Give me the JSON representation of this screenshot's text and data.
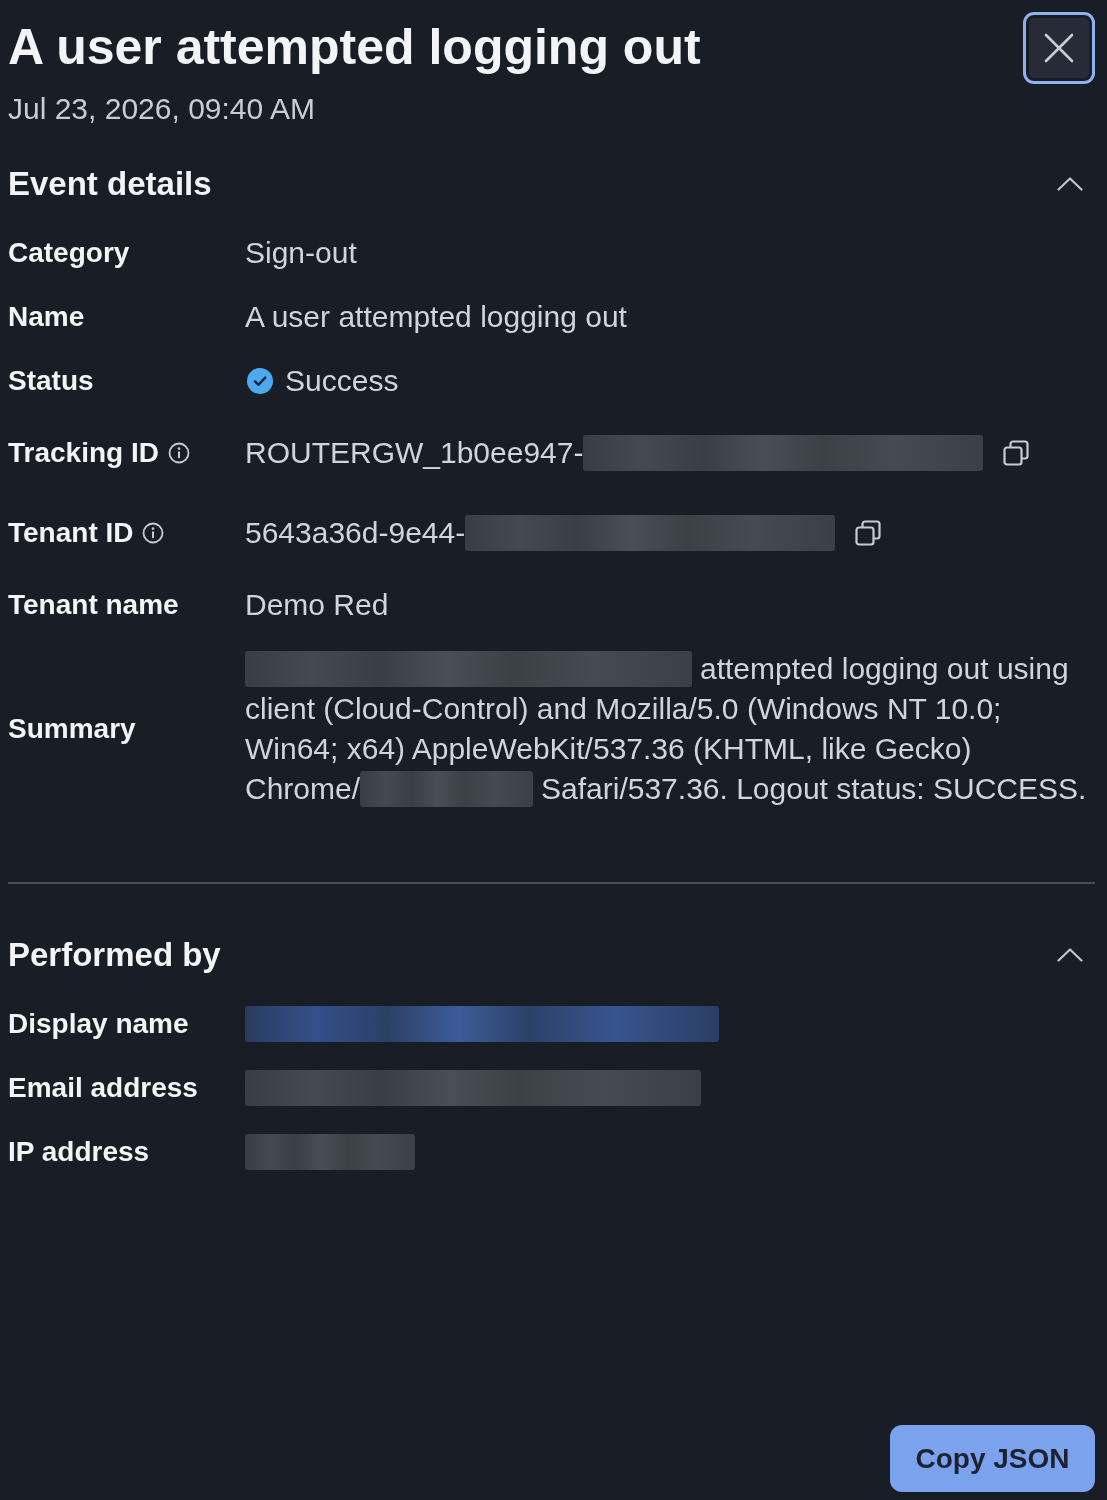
{
  "header": {
    "title": "A user attempted logging out",
    "timestamp": "Jul 23, 2026, 09:40 AM"
  },
  "sections": [
    {
      "title": "Event details",
      "expanded": true,
      "fields": [
        {
          "kind": "text",
          "label": "Category",
          "value": "Sign-out"
        },
        {
          "kind": "text",
          "label": "Name",
          "value": "A user attempted logging out"
        },
        {
          "kind": "status",
          "label": "Status",
          "value": "Success"
        },
        {
          "kind": "text",
          "label": "Tracking ID",
          "info": true,
          "value": "ROUTERGW_1b0ee947-",
          "redacted": true,
          "copyable": true
        },
        {
          "kind": "text",
          "label": "Tenant ID",
          "info": true,
          "value": "5643a36d-9e44-",
          "redacted": true,
          "copyable": true
        },
        {
          "kind": "text",
          "label": "Tenant name",
          "value": "Demo Red"
        },
        {
          "kind": "summary",
          "label": "Summary",
          "lines": [
            [
              {
                "kind": "redacted"
              },
              {
                "kind": "text",
                "text": "attempted logging out using"
              }
            ],
            [
              {
                "kind": "text",
                "text": "client (Cloud-Control) and Mozilla/5.0 (Windows NT 10.0;"
              }
            ],
            [
              {
                "kind": "text",
                "text": "Win64; x64) AppleWebKit/537.36 (KHTML, like Gecko)"
              }
            ],
            [
              {
                "kind": "text",
                "text": "Chrome/"
              },
              {
                "kind": "redacted"
              },
              {
                "kind": "text",
                "text": "Safari/537.36. Logout status: SUCCESS."
              }
            ]
          ]
        }
      ]
    },
    {
      "title": "Performed by",
      "expanded": true,
      "fields": [
        {
          "kind": "text",
          "label": "Display name",
          "redacted": true,
          "link": true
        },
        {
          "kind": "text",
          "label": "Email address",
          "redacted": true
        },
        {
          "kind": "text",
          "label": "IP address",
          "redacted": true
        }
      ]
    }
  ],
  "footer": {
    "button": "Copy JSON"
  }
}
